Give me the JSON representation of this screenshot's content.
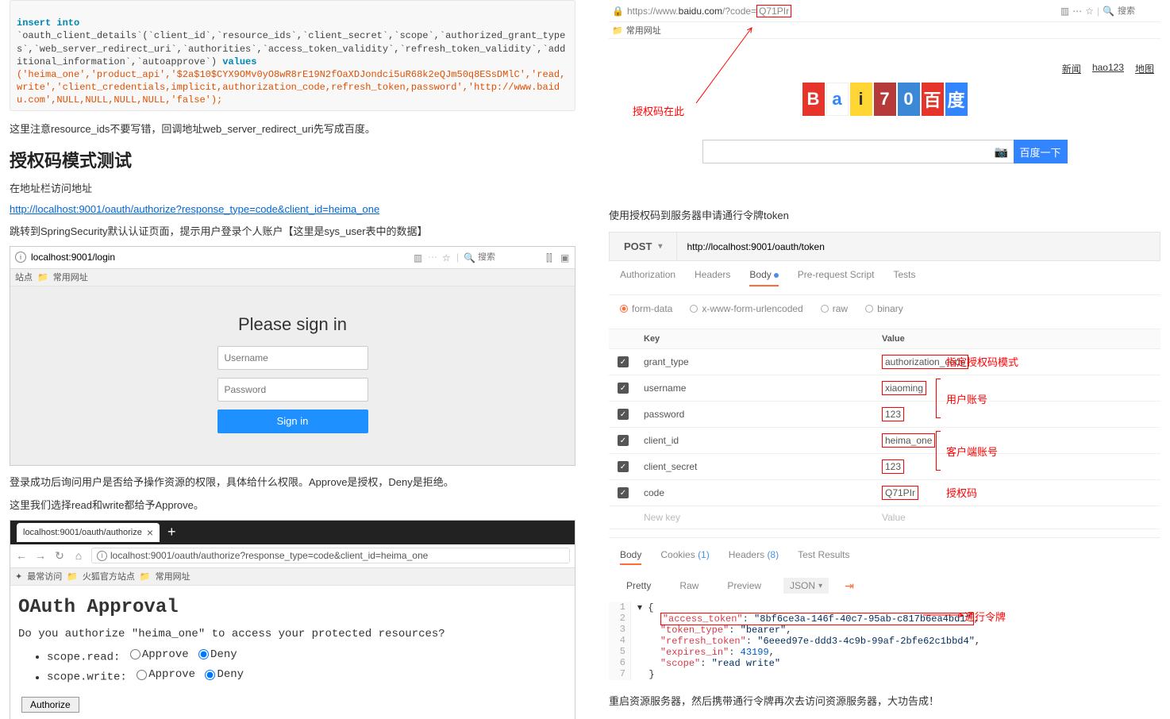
{
  "left": {
    "sql": {
      "insert": "insert into",
      "table": "`oauth_client_details`(`client_id`,`resource_ids`,`client_secret`,`scope`,`authorized_grant_types`,`web_server_redirect_uri`,`authorities`,`access_token_validity`,`refresh_token_validity`,`additional_information`,`autoapprove`) ",
      "values_kw": "values",
      "values": "('heima_one','product_api','$2a$10$CYX9OMv0yO8wR8rE19N2fOaXDJondci5uR68k2eQJm50q8ESsDMlC','read,write','client_credentials,implicit,authorization_code,refresh_token,password','http://www.baidu.com',NULL,NULL,NULL,NULL,'false');"
    },
    "note1": "这里注意resource_ids不要写错，回调地址web_server_redirect_uri先写成百度。",
    "heading": "授权码模式测试",
    "note2": "在地址栏访问地址",
    "auth_url": "http://localhost:9001/oauth/authorize?response_type=code&client_id=heima_one",
    "note3": "跳转到SpringSecurity默认认证页面，提示用户登录个人账户【这里是sys_user表中的数据】",
    "login_url": "localhost:9001/login",
    "search_ph": "搜索",
    "bookmark_folder": "常用网址",
    "login_title": "Please sign in",
    "username_ph": "Username",
    "password_ph": "Password",
    "signin_btn": "Sign in",
    "note4": "登录成功后询问用户是否给予操作资源的权限，具体给什么权限。Approve是授权，Deny是拒绝。",
    "note5": "这里我们选择read和write都给予Approve。",
    "tab_label": "localhost:9001/oauth/authorize",
    "oauth_url": "localhost:9001/oauth/authorize?response_type=code&client_id=heima_one",
    "most_visited": "最常访问",
    "firefox_sites": "火狐官方站点",
    "oauth_title": "OAuth Approval",
    "oauth_q": "Do you authorize \"heima_one\" to access your protected resources?",
    "scope_read": "scope.read:",
    "scope_write": "scope.write:",
    "approve": "Approve",
    "deny": "Deny",
    "authorize_btn": "Authorize",
    "site_label": "站点"
  },
  "right": {
    "url_pre": "https://www.",
    "url_host": "baidu.com",
    "url_path": "/?code=",
    "url_code": "Q71PIr",
    "search_ph": "搜索",
    "bookmark_folder": "常用网址",
    "nav_links": [
      "新闻",
      "hao123",
      "地图"
    ],
    "ann_code": "授权码在此",
    "search_btn": "百度一下",
    "note_token": "使用授权码到服务器申请通行令牌token",
    "pm_method": "POST",
    "pm_url": "http://localhost:9001/oauth/token",
    "pm_tabs": [
      "Authorization",
      "Headers",
      "Body",
      "Pre-request Script",
      "Tests"
    ],
    "pm_radios": [
      "form-data",
      "x-www-form-urlencoded",
      "raw",
      "binary"
    ],
    "kv_header": {
      "key": "Key",
      "val": "Value"
    },
    "rows": [
      {
        "k": "grant_type",
        "v": "authorization_code"
      },
      {
        "k": "username",
        "v": "xiaoming"
      },
      {
        "k": "password",
        "v": "123"
      },
      {
        "k": "client_id",
        "v": "heima_one"
      },
      {
        "k": "client_secret",
        "v": "123"
      },
      {
        "k": "code",
        "v": "Q71PIr"
      }
    ],
    "new_key": "New key",
    "new_val": "Value",
    "labels": {
      "grant": "指定授权码模式",
      "user": "用户账号",
      "client": "客户端账号",
      "code": "授权码"
    },
    "resp_tabs": {
      "body": "Body",
      "cookies": "Cookies",
      "cookies_n": "(1)",
      "headers": "Headers",
      "headers_n": "(8)",
      "test": "Test Results"
    },
    "resp_sub": {
      "pretty": "Pretty",
      "raw": "Raw",
      "preview": "Preview",
      "json": "JSON"
    },
    "json": {
      "l1": "{",
      "l2_k": "\"access_token\"",
      "l2_v": "\"8bf6ce3a-146f-40c7-95ab-c817b6ea4bd1\"",
      "l3_k": "\"token_type\"",
      "l3_v": "\"bearer\"",
      "l4_k": "\"refresh_token\"",
      "l4_v": "\"6eeed97e-ddd3-4c9b-99af-2bfe62c1bbd4\"",
      "l5_k": "\"expires_in\"",
      "l5_v": "43199",
      "l6_k": "\"scope\"",
      "l6_v": "\"read write\""
    },
    "token_label": "通行令牌",
    "note_final": "重启资源服务器，然后携带通行令牌再次去访问资源服务器，大功告成！"
  }
}
